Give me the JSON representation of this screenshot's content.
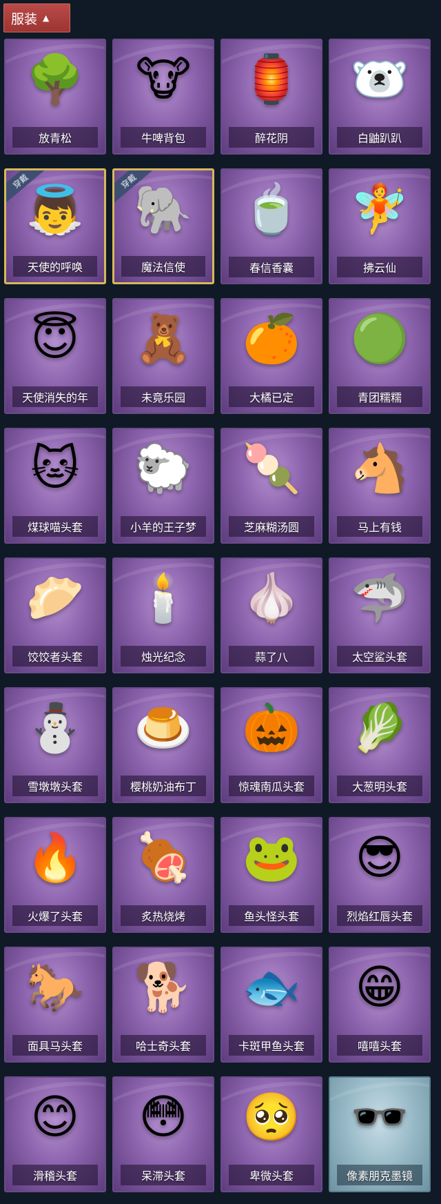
{
  "header": {
    "tab_label": "服装"
  },
  "badge_text": "穿戴",
  "items": [
    {
      "name": "放青松",
      "icon": "🌳",
      "equipped": false,
      "theme": "purple"
    },
    {
      "name": "牛啤背包",
      "icon": "🐮",
      "equipped": false,
      "theme": "purple"
    },
    {
      "name": "醉花阴",
      "icon": "🏮",
      "equipped": false,
      "theme": "purple"
    },
    {
      "name": "白鼬趴趴",
      "icon": "🐻‍❄️",
      "equipped": false,
      "theme": "purple"
    },
    {
      "name": "天使的呼唤",
      "icon": "👼",
      "equipped": true,
      "theme": "purple"
    },
    {
      "name": "魔法信使",
      "icon": "🐘",
      "equipped": true,
      "theme": "purple"
    },
    {
      "name": "春信香囊",
      "icon": "🍵",
      "equipped": false,
      "theme": "purple"
    },
    {
      "name": "拂云仙",
      "icon": "🧚",
      "equipped": false,
      "theme": "purple"
    },
    {
      "name": "天使消失的年",
      "icon": "😇",
      "equipped": false,
      "theme": "purple"
    },
    {
      "name": "未竟乐园",
      "icon": "🧸",
      "equipped": false,
      "theme": "purple"
    },
    {
      "name": "大橘已定",
      "icon": "🍊",
      "equipped": false,
      "theme": "purple"
    },
    {
      "name": "青团糯糯",
      "icon": "🟢",
      "equipped": false,
      "theme": "purple"
    },
    {
      "name": "煤球喵头套",
      "icon": "🐱",
      "equipped": false,
      "theme": "purple"
    },
    {
      "name": "小羊的王子梦",
      "icon": "🐑",
      "equipped": false,
      "theme": "purple"
    },
    {
      "name": "芝麻糊汤圆",
      "icon": "🍡",
      "equipped": false,
      "theme": "purple"
    },
    {
      "name": "马上有钱",
      "icon": "🐴",
      "equipped": false,
      "theme": "purple"
    },
    {
      "name": "饺饺者头套",
      "icon": "🥟",
      "equipped": false,
      "theme": "purple"
    },
    {
      "name": "烛光纪念",
      "icon": "🕯️",
      "equipped": false,
      "theme": "purple"
    },
    {
      "name": "蒜了八",
      "icon": "🧄",
      "equipped": false,
      "theme": "purple"
    },
    {
      "name": "太空鲨头套",
      "icon": "🦈",
      "equipped": false,
      "theme": "purple"
    },
    {
      "name": "雪墩墩头套",
      "icon": "⛄",
      "equipped": false,
      "theme": "purple"
    },
    {
      "name": "樱桃奶油布丁",
      "icon": "🍮",
      "equipped": false,
      "theme": "purple"
    },
    {
      "name": "惊魂南瓜头套",
      "icon": "🎃",
      "equipped": false,
      "theme": "purple"
    },
    {
      "name": "大葱明头套",
      "icon": "🥬",
      "equipped": false,
      "theme": "purple"
    },
    {
      "name": "火爆了头套",
      "icon": "🔥",
      "equipped": false,
      "theme": "purple"
    },
    {
      "name": "炙热烧烤",
      "icon": "🍖",
      "equipped": false,
      "theme": "purple"
    },
    {
      "name": "鱼头怪头套",
      "icon": "🐸",
      "equipped": false,
      "theme": "purple"
    },
    {
      "name": "烈焰红唇头套",
      "icon": "😎",
      "equipped": false,
      "theme": "purple"
    },
    {
      "name": "面具马头套",
      "icon": "🐎",
      "equipped": false,
      "theme": "purple"
    },
    {
      "name": "哈士奇头套",
      "icon": "🐕",
      "equipped": false,
      "theme": "purple"
    },
    {
      "name": "卡斑甲鱼头套",
      "icon": "🐟",
      "equipped": false,
      "theme": "purple"
    },
    {
      "name": "嘻嘻头套",
      "icon": "😁",
      "equipped": false,
      "theme": "purple"
    },
    {
      "name": "滑稽头套",
      "icon": "😊",
      "equipped": false,
      "theme": "purple"
    },
    {
      "name": "呆滞头套",
      "icon": "😳",
      "equipped": false,
      "theme": "purple"
    },
    {
      "name": "卑微头套",
      "icon": "🥺",
      "equipped": false,
      "theme": "purple"
    },
    {
      "name": "像素朋克墨镜",
      "icon": "🕶️",
      "equipped": false,
      "theme": "teal"
    }
  ]
}
